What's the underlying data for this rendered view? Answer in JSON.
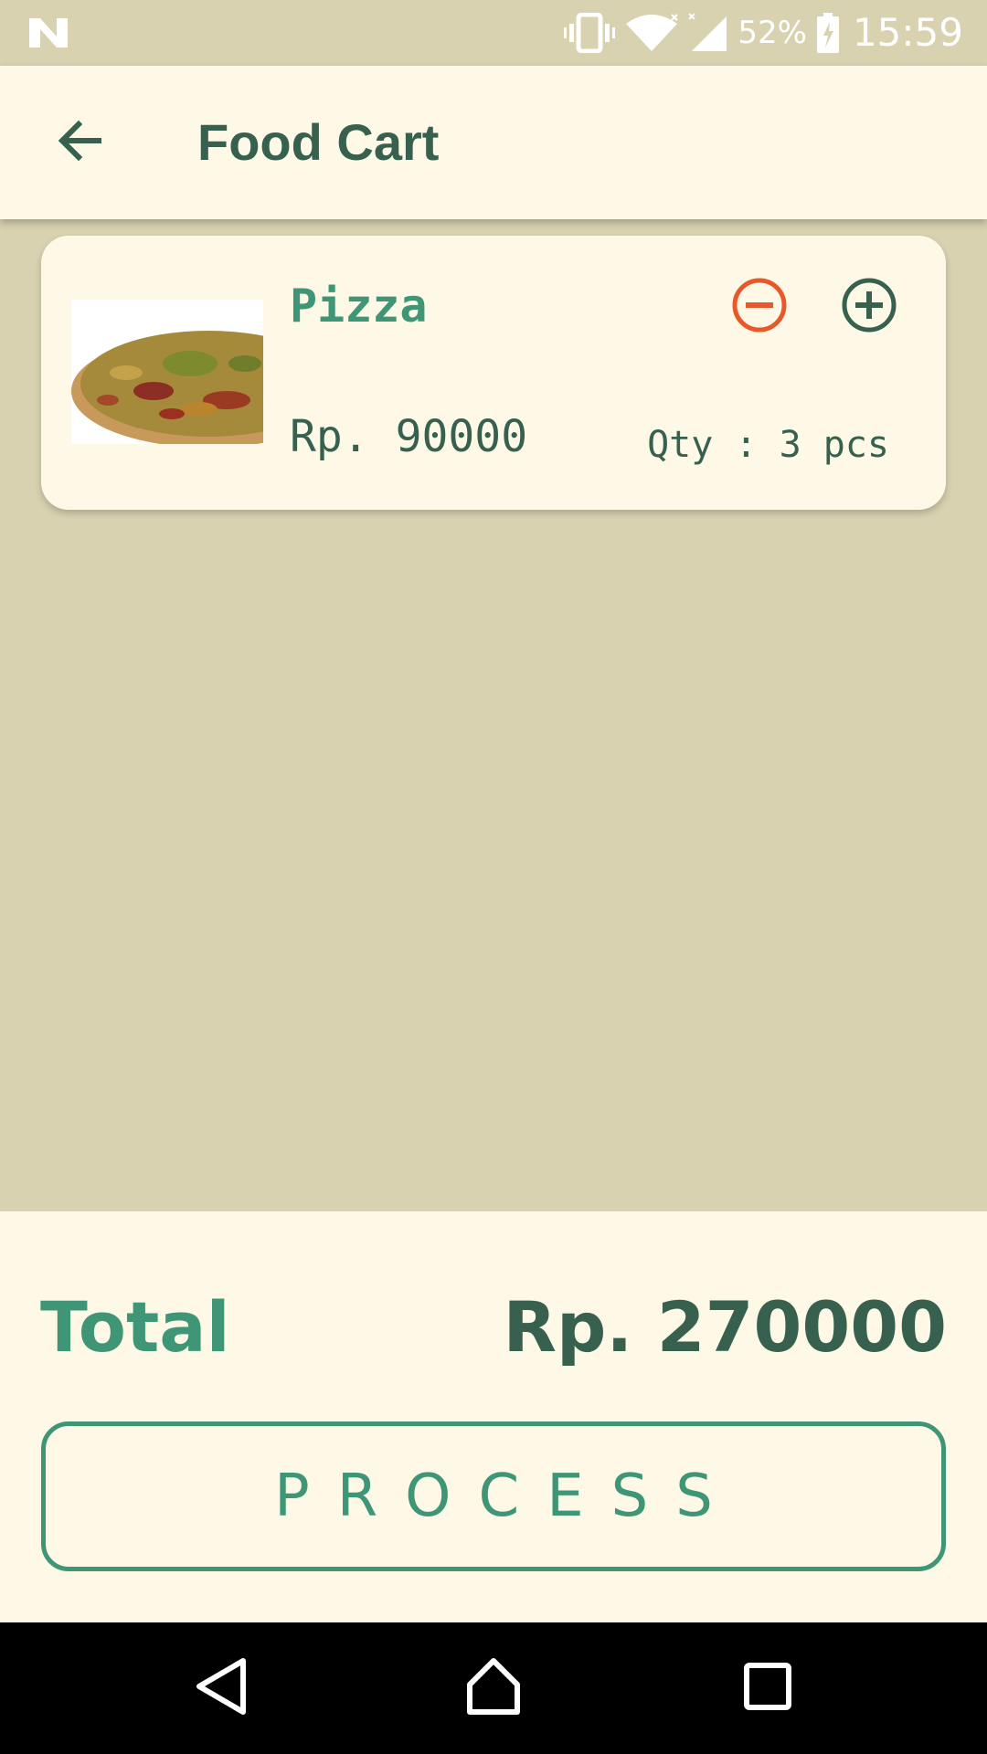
{
  "status_bar": {
    "logo_icon": "n-logo-icon",
    "battery": "52%",
    "time": "15:59",
    "icons": [
      "vibrate-icon",
      "wifi-icon",
      "signal-icon",
      "battery-charging-icon"
    ]
  },
  "app_bar": {
    "back_icon": "arrow-back-icon",
    "title": "Food Cart"
  },
  "cart": {
    "items": [
      {
        "name": "Pizza",
        "price": "Rp. 90000",
        "qty": "Qty : 3 pcs",
        "image_icon": "pizza-image",
        "decrease_icon": "minus-circle-icon",
        "increase_icon": "plus-circle-icon"
      }
    ]
  },
  "summary": {
    "total_label": "Total",
    "total_value": "Rp. 270000",
    "process_label": "PROCESS"
  },
  "nav_bar": {
    "icons": [
      "nav-back-icon",
      "nav-home-icon",
      "nav-recents-icon"
    ]
  },
  "colors": {
    "background": "#d8d2b0",
    "surface": "#fdf9e6",
    "primary_dark": "#37604f",
    "primary": "#3f9677",
    "accent_minus": "#e8582a"
  }
}
